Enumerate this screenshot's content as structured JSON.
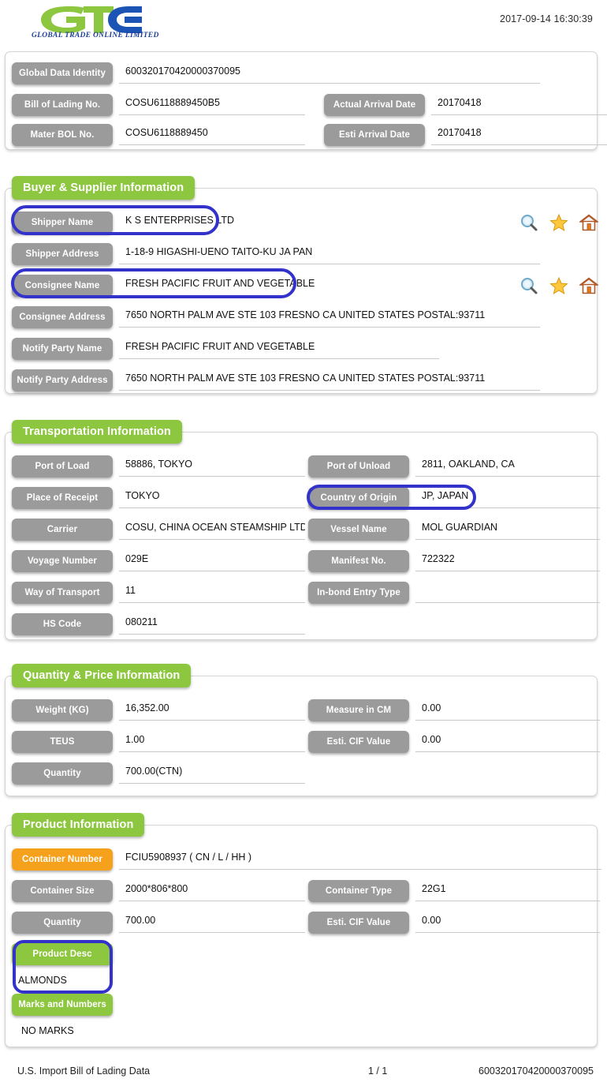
{
  "header": {
    "logo_text": "GTO",
    "logo_subtitle": "GLOBAL TRADE  ONLINE LIMITED",
    "datetime": "2017-09-14 16:30:39"
  },
  "identity_section": {
    "fields": [
      {
        "label": "Global Data Identity",
        "value": "600320170420000370095"
      },
      {
        "label": "Bill of Lading No.",
        "value": "COSU6118889450B5"
      },
      {
        "label": "Mater BOL No.",
        "value": "COSU6118889450"
      }
    ],
    "right_fields": [
      {
        "label": "Actual Arrival Date",
        "value": "20170418"
      },
      {
        "label": "Esti Arrival Date",
        "value": "20170418"
      }
    ]
  },
  "buyer_supplier_section": {
    "title": "Buyer & Supplier Information",
    "fields": [
      {
        "label": "Shipper Name",
        "value": "K S ENTERPRISES LTD"
      },
      {
        "label": "Shipper Address",
        "value": "1-18-9 HIGASHI-UENO TAITO-KU JA PAN"
      },
      {
        "label": "Consignee Name",
        "value": "FRESH PACIFIC FRUIT AND VEGETABLE"
      },
      {
        "label": "Consignee Address",
        "value": "7650 NORTH PALM AVE STE 103 FRESNO CA UNITED STATES POSTAL:93711"
      },
      {
        "label": "Notify Party Name",
        "value": "FRESH PACIFIC FRUIT AND VEGETABLE"
      },
      {
        "label": "Notify Party Address",
        "value": "7650 NORTH PALM AVE STE 103 FRESNO CA UNITED STATES POSTAL:93711"
      }
    ],
    "icons": [
      "search-icon",
      "star-icon",
      "home-icon"
    ]
  },
  "transportation_section": {
    "title": "Transportation Information",
    "left_fields": [
      {
        "label": "Port of Load",
        "value": "58886, TOKYO"
      },
      {
        "label": "Place of Receipt",
        "value": "TOKYO"
      },
      {
        "label": "Carrier",
        "value": "COSU, CHINA OCEAN STEAMSHIP LTD"
      },
      {
        "label": "Voyage Number",
        "value": "029E"
      },
      {
        "label": "Way of Transport",
        "value": "11"
      },
      {
        "label": "HS Code",
        "value": "080211"
      }
    ],
    "right_fields": [
      {
        "label": "Port of Unload",
        "value": "2811, OAKLAND, CA"
      },
      {
        "label": "Country of Origin",
        "value": "JP, JAPAN"
      },
      {
        "label": "Vessel Name",
        "value": "MOL GUARDIAN"
      },
      {
        "label": "Manifest No.",
        "value": "722322"
      },
      {
        "label": "In-bond Entry Type",
        "value": ""
      }
    ]
  },
  "quantity_price_section": {
    "title": "Quantity & Price Information",
    "left_fields": [
      {
        "label": "Weight (KG)",
        "value": "16,352.00"
      },
      {
        "label": "TEUS",
        "value": "1.00"
      },
      {
        "label": "Quantity",
        "value": "700.00(CTN)"
      }
    ],
    "right_fields": [
      {
        "label": "Measure in CM",
        "value": "0.00"
      },
      {
        "label": "Esti. CIF Value",
        "value": "0.00"
      }
    ]
  },
  "product_section": {
    "title": "Product Information",
    "container_number": {
      "label": "Container Number",
      "value": "FCIU5908937 ( CN / L / HH )"
    },
    "left_fields": [
      {
        "label": "Container Size",
        "value": "2000*806*800"
      },
      {
        "label": "Quantity",
        "value": "700.00"
      }
    ],
    "right_fields": [
      {
        "label": "Container Type",
        "value": "22G1"
      },
      {
        "label": "Esti. CIF Value",
        "value": "0.00"
      }
    ],
    "product_desc": {
      "label": "Product Desc",
      "value": "ALMONDS"
    },
    "marks": {
      "label": "Marks and Numbers",
      "value": "NO MARKS"
    }
  },
  "footer": {
    "left": "U.S. Import Bill of Lading Data",
    "center": "1 / 1",
    "right": "600320170420000370095"
  },
  "colors": {
    "green": "#8dc63f",
    "orange": "#f5a11b",
    "grey": "#9b9b9b",
    "annotation_blue": "#3333cc",
    "logo_blue": "#1d3f94"
  }
}
